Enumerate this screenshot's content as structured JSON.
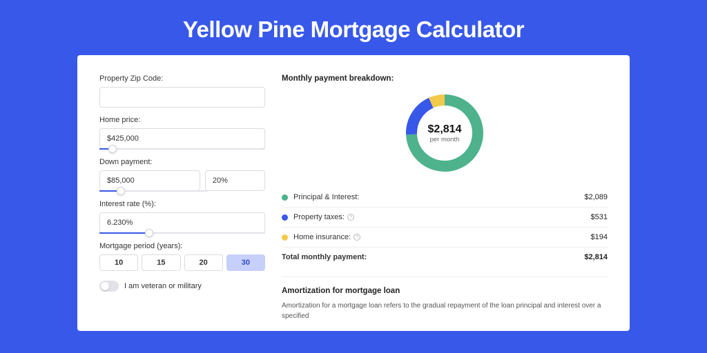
{
  "header": {
    "title": "Yellow Pine Mortgage Calculator"
  },
  "form": {
    "zip_label": "Property Zip Code:",
    "zip_value": "",
    "price_label": "Home price:",
    "price_value": "$425,000",
    "price_slider_pct": 8,
    "down_label": "Down payment:",
    "down_value": "$85,000",
    "down_pct_value": "20%",
    "down_slider_pct": 20,
    "rate_label": "Interest rate (%):",
    "rate_value": "6.230%",
    "rate_slider_pct": 30,
    "period_label": "Mortgage period (years):",
    "periods": [
      "10",
      "15",
      "20",
      "30"
    ],
    "period_active_index": 3,
    "veteran_label": "I am veteran or military"
  },
  "breakdown": {
    "title": "Monthly payment breakdown:",
    "total": "$2,814",
    "per_month": "per month",
    "items": [
      {
        "label": "Principal & Interest:",
        "value": "$2,089",
        "color": "#4eb28d",
        "info": false
      },
      {
        "label": "Property taxes:",
        "value": "$531",
        "color": "#3858e9",
        "info": true
      },
      {
        "label": "Home insurance:",
        "value": "$194",
        "color": "#f3c94b",
        "info": true
      }
    ],
    "total_label": "Total monthly payment:"
  },
  "amortization": {
    "title": "Amortization for mortgage loan",
    "body": "Amortization for a mortgage loan refers to the gradual repayment of the loan principal and interest over a specified"
  },
  "chart_data": {
    "type": "pie",
    "title": "Monthly payment breakdown",
    "series": [
      {
        "name": "Principal & Interest",
        "value": 2089,
        "color": "#4eb28d"
      },
      {
        "name": "Property taxes",
        "value": 531,
        "color": "#3858e9"
      },
      {
        "name": "Home insurance",
        "value": 194,
        "color": "#f3c94b"
      }
    ],
    "total": 2814
  }
}
